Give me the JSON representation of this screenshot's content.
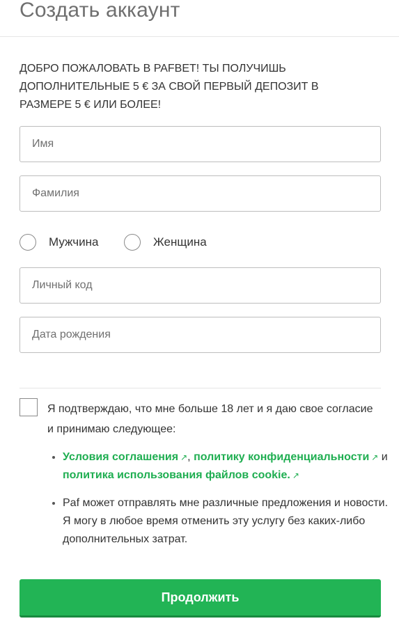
{
  "header": {
    "title": "Создать аккаунт"
  },
  "promo": {
    "text": "ДОБРО ПОЖАЛОВАТЬ В PAFBET! ТЫ ПОЛУЧИШЬ ДОПОЛНИТЕЛЬНЫЕ 5 € ЗА СВОЙ ПЕРВЫЙ ДЕПОЗИТ В РАЗМЕРЕ 5 € ИЛИ БОЛЕЕ!"
  },
  "form": {
    "first_name": {
      "placeholder": "Имя",
      "value": ""
    },
    "last_name": {
      "placeholder": "Фамилия",
      "value": ""
    },
    "gender": {
      "male_label": "Мужчина",
      "female_label": "Женщина"
    },
    "personal_code": {
      "placeholder": "Личный код",
      "value": ""
    },
    "birth_date": {
      "placeholder": "Дата рождения",
      "value": ""
    }
  },
  "consent": {
    "text": "Я подтверждаю, что мне больше 18 лет и я даю свое согласие и принимаю следующее:",
    "terms_link": "Условия соглашения",
    "sep_comma": ",",
    "privacy_link": "политику конфиденциальности",
    "and_text": "и",
    "cookie_link": "политика использования файлов cookie.",
    "offers_text": "Paf может отправлять мне различные предложения и новости. Я могу в любое время отменить эту услугу без каких-либо дополнительных затрат.",
    "external_icon": "external-link-icon"
  },
  "actions": {
    "continue_label": "Продолжить"
  },
  "colors": {
    "accent": "#22b455",
    "link": "#1fae51",
    "title": "#6f6f6f"
  }
}
